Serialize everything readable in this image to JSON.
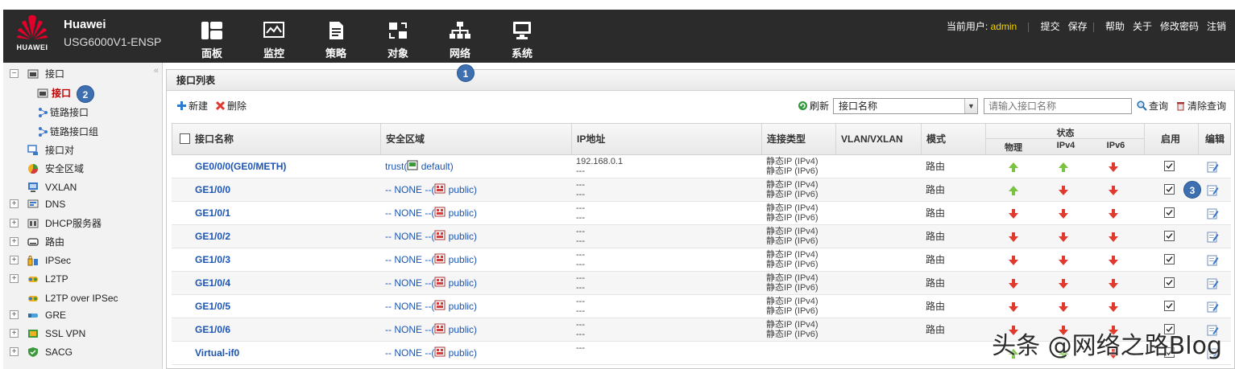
{
  "header": {
    "brand": "Huawei",
    "model": "USG6000V1-ENSP",
    "logo_text": "HUAWEI",
    "nav": [
      {
        "label": "面板",
        "icon": "dashboard-icon"
      },
      {
        "label": "监控",
        "icon": "monitor-icon"
      },
      {
        "label": "策略",
        "icon": "policy-icon"
      },
      {
        "label": "对象",
        "icon": "object-icon"
      },
      {
        "label": "网络",
        "icon": "network-icon",
        "active": true
      },
      {
        "label": "系统",
        "icon": "system-icon"
      }
    ],
    "user_label": "当前用户:",
    "user_name": "admin",
    "links": [
      "提交",
      "保存",
      "帮助",
      "关于",
      "修改密码",
      "注销"
    ]
  },
  "sidebar": {
    "items": [
      {
        "label": "接口",
        "icon": "interface-icon",
        "expander": "−"
      },
      {
        "label": "接口",
        "icon": "interface-icon",
        "selected": true
      },
      {
        "label": "链路接口",
        "icon": "link-icon"
      },
      {
        "label": "链路接口组",
        "icon": "link-group-icon"
      },
      {
        "label": "接口对",
        "icon": "interface-pair-icon"
      },
      {
        "label": "安全区域",
        "icon": "security-zone-icon"
      },
      {
        "label": "VXLAN",
        "icon": "vxlan-icon"
      },
      {
        "label": "DNS",
        "icon": "dns-icon",
        "expander": "+"
      },
      {
        "label": "DHCP服务器",
        "icon": "dhcp-icon",
        "expander": "+"
      },
      {
        "label": "路由",
        "icon": "route-icon",
        "expander": "+"
      },
      {
        "label": "IPSec",
        "icon": "ipsec-icon",
        "expander": "+"
      },
      {
        "label": "L2TP",
        "icon": "l2tp-icon",
        "expander": "+"
      },
      {
        "label": "L2TP over IPSec",
        "icon": "l2tp-ipsec-icon"
      },
      {
        "label": "GRE",
        "icon": "gre-icon",
        "expander": "+"
      },
      {
        "label": "SSL VPN",
        "icon": "sslvpn-icon",
        "expander": "+"
      },
      {
        "label": "SACG",
        "icon": "sacg-icon",
        "expander": "+"
      }
    ]
  },
  "main": {
    "title": "接口列表",
    "toolbar": {
      "new_label": "新建",
      "delete_label": "删除",
      "refresh_label": "刷新",
      "filter_select": "接口名称",
      "search_placeholder": "请输入接口名称",
      "query_label": "查询",
      "clear_label": "清除查询"
    },
    "columns": {
      "name": "接口名称",
      "zone": "安全区域",
      "ip": "IP地址",
      "conn": "连接类型",
      "vlan": "VLAN/VXLAN",
      "mode": "模式",
      "status": "状态",
      "phys": "物理",
      "ipv4": "IPv4",
      "ipv6": "IPv6",
      "enable": "启用",
      "edit": "编辑"
    },
    "rows": [
      {
        "name": "GE0/0/0(GE0/METH)",
        "zone_a": "trust(",
        "zone_b": "default)",
        "zone_icon": "zone-trust-icon",
        "ip1": "192.168.0.1",
        "ip2": "---",
        "conn1": "静态IP (IPv4)",
        "conn2": "静态IP (IPv6)",
        "mode": "路由",
        "phys": "up",
        "ipv4": "up",
        "ipv6": "down",
        "enabled": true
      },
      {
        "name": "GE1/0/0",
        "zone_a": "-- NONE --(",
        "zone_b": "public)",
        "zone_icon": "zone-public-icon",
        "ip1": "---",
        "ip2": "---",
        "conn1": "静态IP (IPv4)",
        "conn2": "静态IP (IPv6)",
        "mode": "路由",
        "phys": "up",
        "ipv4": "down",
        "ipv6": "down",
        "enabled": true
      },
      {
        "name": "GE1/0/1",
        "zone_a": "-- NONE --(",
        "zone_b": "public)",
        "zone_icon": "zone-public-icon",
        "ip1": "---",
        "ip2": "---",
        "conn1": "静态IP (IPv4)",
        "conn2": "静态IP (IPv6)",
        "mode": "路由",
        "phys": "down",
        "ipv4": "down",
        "ipv6": "down",
        "enabled": true
      },
      {
        "name": "GE1/0/2",
        "zone_a": "-- NONE --(",
        "zone_b": "public)",
        "zone_icon": "zone-public-icon",
        "ip1": "---",
        "ip2": "---",
        "conn1": "静态IP (IPv4)",
        "conn2": "静态IP (IPv6)",
        "mode": "路由",
        "phys": "down",
        "ipv4": "down",
        "ipv6": "down",
        "enabled": true
      },
      {
        "name": "GE1/0/3",
        "zone_a": "-- NONE --(",
        "zone_b": "public)",
        "zone_icon": "zone-public-icon",
        "ip1": "---",
        "ip2": "---",
        "conn1": "静态IP (IPv4)",
        "conn2": "静态IP (IPv6)",
        "mode": "路由",
        "phys": "down",
        "ipv4": "down",
        "ipv6": "down",
        "enabled": true
      },
      {
        "name": "GE1/0/4",
        "zone_a": "-- NONE --(",
        "zone_b": "public)",
        "zone_icon": "zone-public-icon",
        "ip1": "---",
        "ip2": "---",
        "conn1": "静态IP (IPv4)",
        "conn2": "静态IP (IPv6)",
        "mode": "路由",
        "phys": "down",
        "ipv4": "down",
        "ipv6": "down",
        "enabled": true
      },
      {
        "name": "GE1/0/5",
        "zone_a": "-- NONE --(",
        "zone_b": "public)",
        "zone_icon": "zone-public-icon",
        "ip1": "---",
        "ip2": "---",
        "conn1": "静态IP (IPv4)",
        "conn2": "静态IP (IPv6)",
        "mode": "路由",
        "phys": "down",
        "ipv4": "down",
        "ipv6": "down",
        "enabled": true
      },
      {
        "name": "GE1/0/6",
        "zone_a": "-- NONE --(",
        "zone_b": "public)",
        "zone_icon": "zone-public-icon",
        "ip1": "---",
        "ip2": "---",
        "conn1": "静态IP (IPv4)",
        "conn2": "静态IP (IPv6)",
        "mode": "路由",
        "phys": "down",
        "ipv4": "down",
        "ipv6": "down",
        "enabled": true
      },
      {
        "name": "Virtual-if0",
        "zone_a": "-- NONE --(",
        "zone_b": "public)",
        "zone_icon": "zone-public-icon",
        "ip1": "---",
        "ip2": "",
        "conn1": "",
        "conn2": "",
        "mode": "",
        "phys": "up",
        "ipv4": "up",
        "ipv6": "down",
        "enabled": true
      }
    ]
  },
  "badges": [
    "1",
    "2",
    "3"
  ],
  "watermark": "头条 @网络之路Blog",
  "colors": {
    "topbar": "#2b2b2b",
    "link": "#1d55b0",
    "up": "#7cc242",
    "down": "#e03a2f",
    "badge": "#3d6fb1",
    "selected": "#c00000"
  }
}
